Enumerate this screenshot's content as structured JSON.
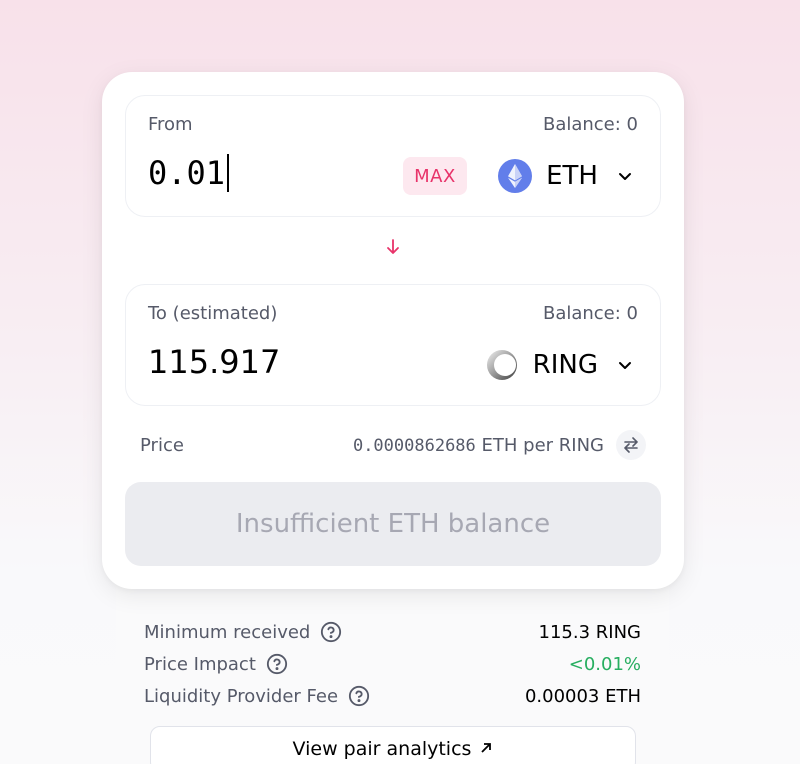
{
  "swap": {
    "from": {
      "label": "From",
      "balance": "Balance: 0",
      "amount": "0.01",
      "max_label": "MAX",
      "token": "ETH",
      "token_icon": "ethereum-logo-icon"
    },
    "to": {
      "label": "To (estimated)",
      "balance": "Balance: 0",
      "amount": "115.917",
      "token": "RING",
      "token_icon": "ring-logo-icon"
    },
    "price": {
      "label": "Price",
      "value_number": "0.0000862686",
      "value_unit": "ETH per RING"
    },
    "submit_label": "Insufficient ETH balance"
  },
  "details": {
    "rows": [
      {
        "label": "Minimum received",
        "value": "115.3 RING"
      },
      {
        "label": "Price Impact",
        "value": "<0.01%"
      },
      {
        "label": "Liquidity Provider Fee",
        "value": "0.00003 ETH"
      }
    ],
    "analytics_label": "View pair analytics",
    "analytics_icon": "arrow-up-right-icon"
  },
  "colors": {
    "accent": "#e8336a",
    "positive": "#27ae60",
    "eth": "#627eea",
    "disabled_text": "#a7a8b3"
  }
}
